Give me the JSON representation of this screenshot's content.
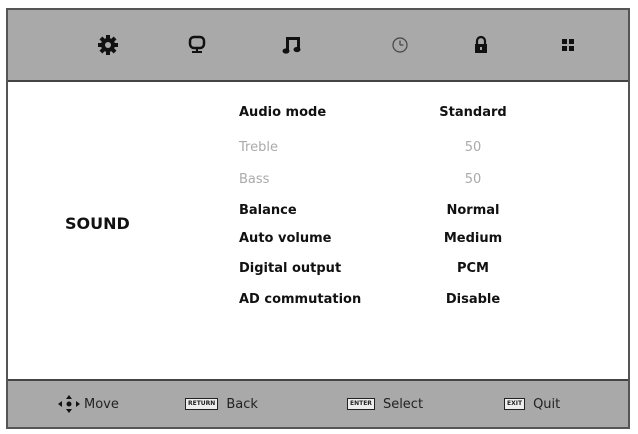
{
  "tabs": [
    {
      "name": "gear-icon"
    },
    {
      "name": "monitor-icon"
    },
    {
      "name": "music-note-icon"
    },
    {
      "name": "clock-icon"
    },
    {
      "name": "lock-icon"
    },
    {
      "name": "grid-icon"
    }
  ],
  "section": {
    "title": "SOUND"
  },
  "menu": [
    {
      "label": "Audio mode",
      "value": "Standard",
      "disabled": false
    },
    {
      "label": "Treble",
      "value": "50",
      "disabled": true
    },
    {
      "label": "Bass",
      "value": "50",
      "disabled": true
    },
    {
      "label": "Balance",
      "value": "Normal",
      "disabled": false
    },
    {
      "label": "Auto volume",
      "value": "Medium",
      "disabled": false
    },
    {
      "label": "Digital output",
      "value": "PCM",
      "disabled": false
    },
    {
      "label": "AD commutation",
      "value": "Disable",
      "disabled": false
    }
  ],
  "hints": {
    "move": "Move",
    "back_key": "RETURN",
    "back": "Back",
    "select_key": "ENTER",
    "select": "Select",
    "quit_key": "EXIT",
    "quit": "Quit"
  },
  "colors": {
    "bar": "#a9a9a9",
    "disabled_text": "#aaaaaa",
    "text": "#111111"
  }
}
